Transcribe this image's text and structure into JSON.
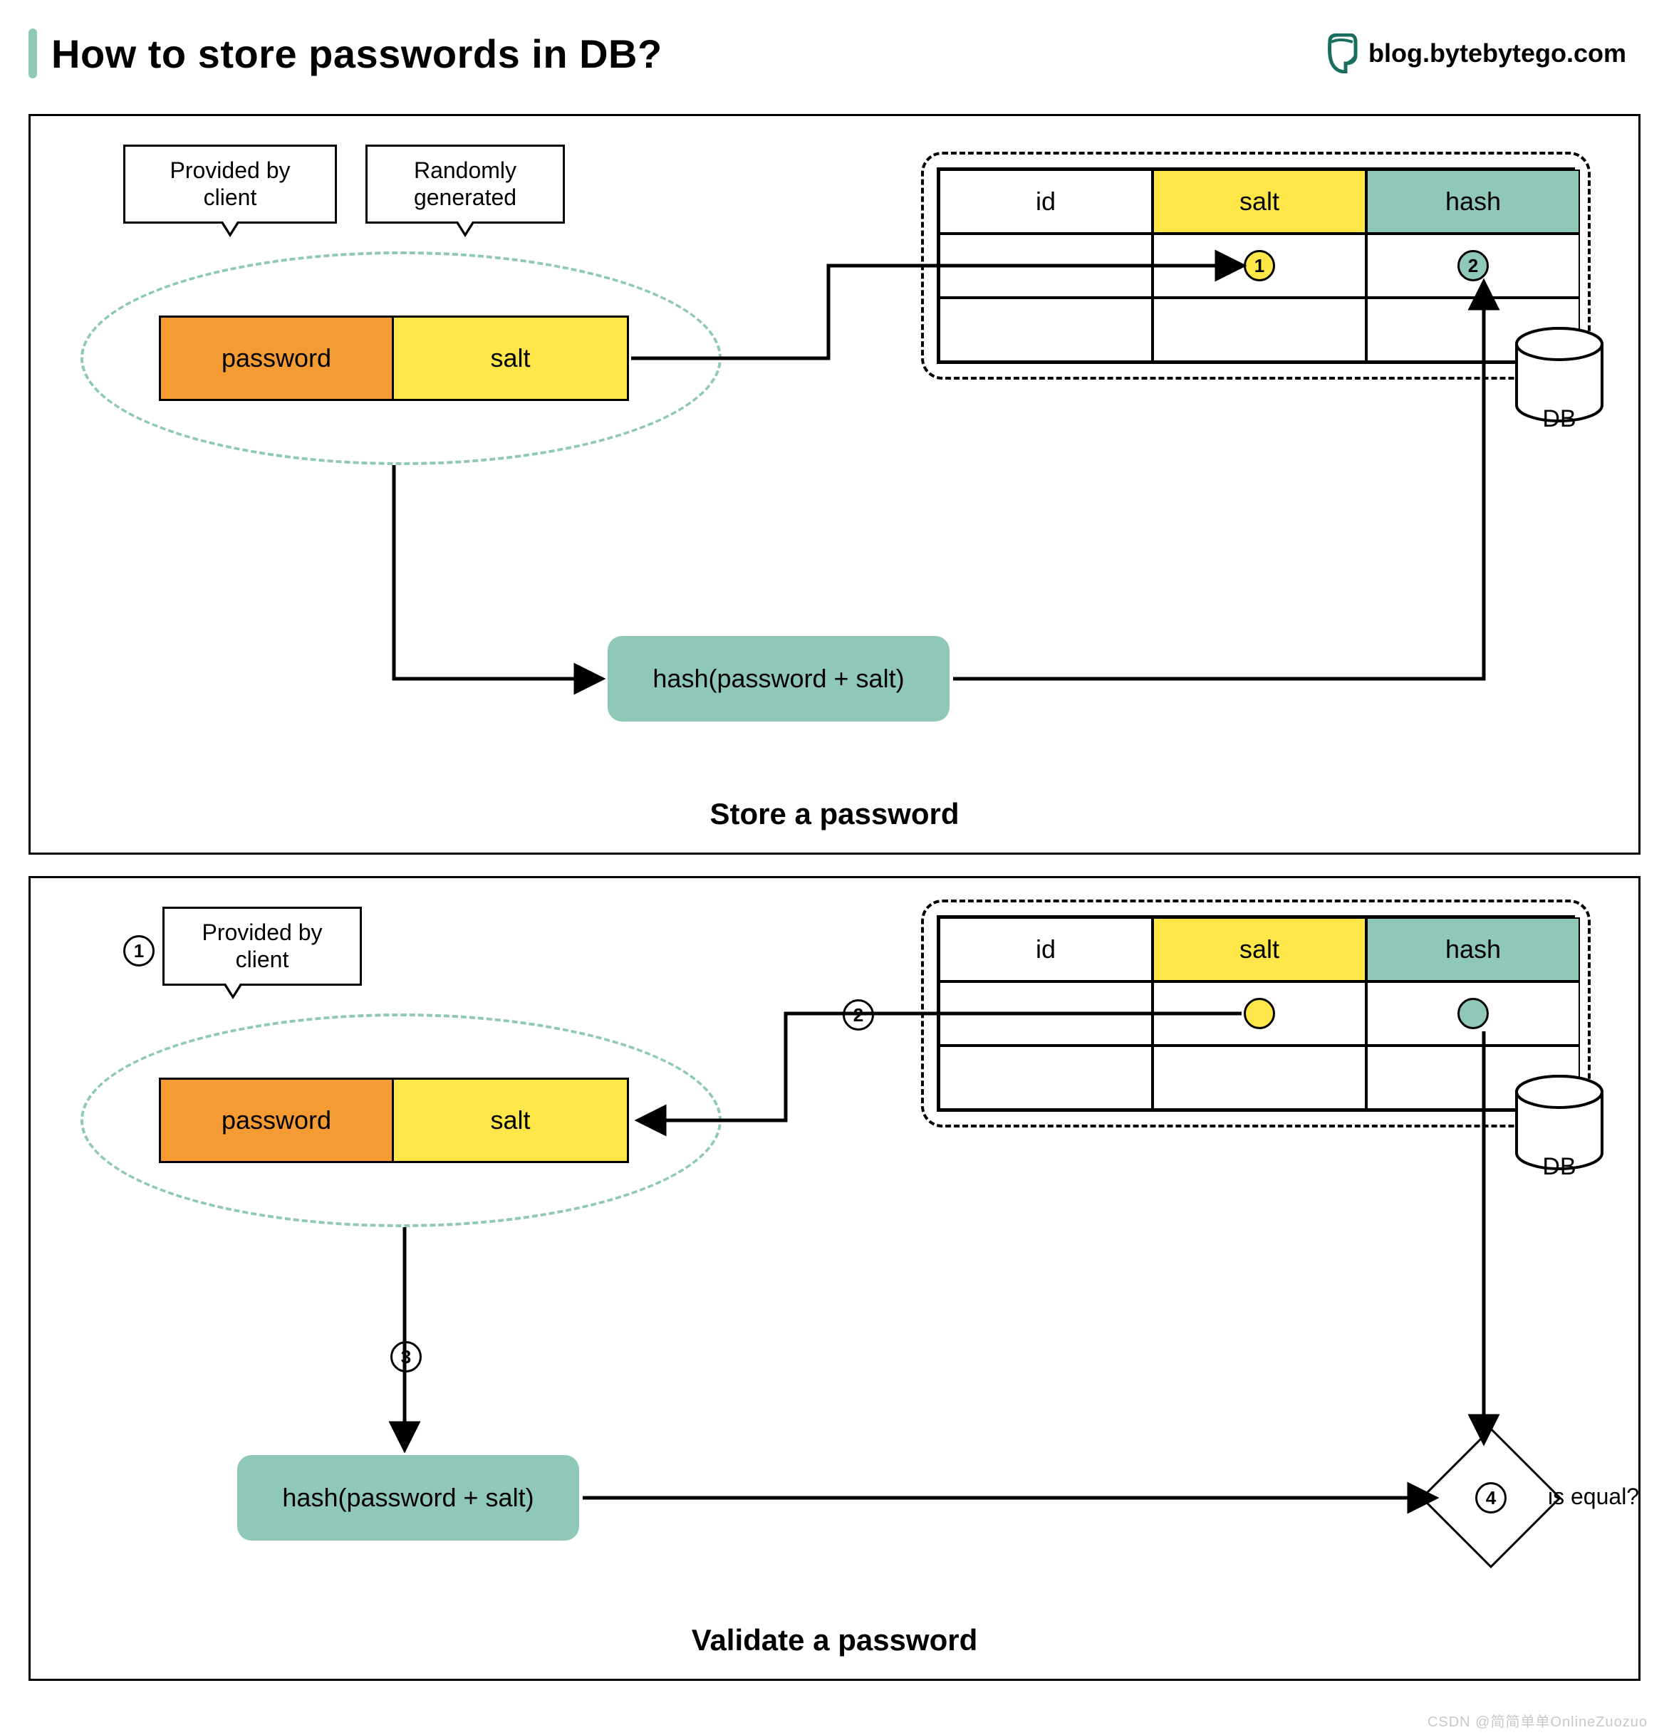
{
  "header": {
    "title": "How to store passwords in DB?",
    "brand": "blog.bytebytego.com"
  },
  "store": {
    "caption": "Store a password",
    "tag_client": "Provided by\nclient",
    "tag_random": "Randomly\ngenerated",
    "cell_password": "password",
    "cell_salt": "salt",
    "hash_label": "hash(password + salt)",
    "db_label": "DB",
    "table_headers": {
      "id": "id",
      "salt": "salt",
      "hash": "hash"
    },
    "badge_salt": "1",
    "badge_hash": "2"
  },
  "validate": {
    "caption": "Validate a password",
    "tag_client": "Provided by\nclient",
    "cell_password": "password",
    "cell_salt": "salt",
    "hash_label": "hash(password + salt)",
    "db_label": "DB",
    "table_headers": {
      "id": "id",
      "salt": "salt",
      "hash": "hash"
    },
    "step1": "1",
    "step2": "2",
    "step3": "3",
    "step4": "4",
    "decision": "is equal?"
  },
  "watermark": "CSDN @简简单单OnlineZuozuo"
}
